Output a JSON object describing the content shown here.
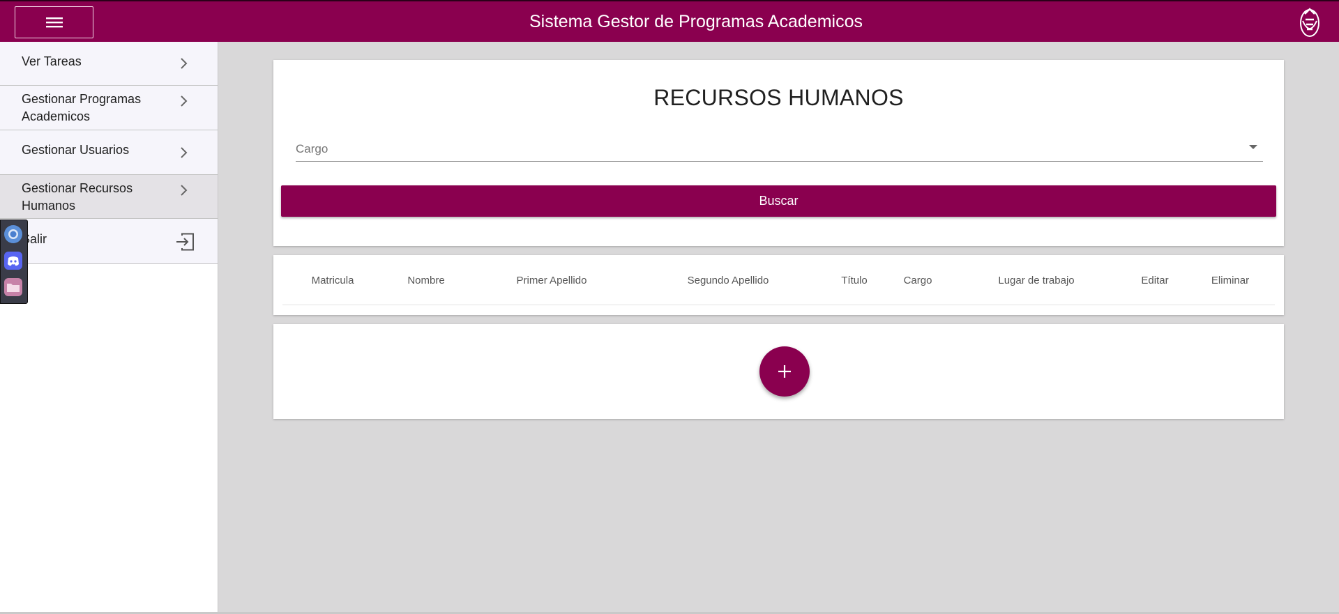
{
  "header": {
    "title": "Sistema Gestor de Programas Academicos",
    "menu_icon": "hamburger-menu-icon",
    "logo": "institution-logo",
    "brand_color": "#8a004f"
  },
  "sidebar": {
    "items": [
      {
        "label": "Ver Tareas",
        "icon": "chevron-right-icon"
      },
      {
        "label": "Gestionar Programas Academicos",
        "icon": "chevron-right-icon"
      },
      {
        "label": "Gestionar Usuarios",
        "icon": "chevron-right-icon"
      },
      {
        "label": "Gestionar Recursos Humanos",
        "icon": "chevron-right-icon",
        "active": true
      },
      {
        "label": "Salir",
        "icon": "logout-icon"
      }
    ]
  },
  "dock": {
    "apps": [
      "browser-icon",
      "discord-icon",
      "folder-icon"
    ]
  },
  "search_card": {
    "title": "RECURSOS HUMANOS",
    "select_placeholder": "Cargo",
    "search_button": "Buscar"
  },
  "table": {
    "columns": [
      "Matricula",
      "Nombre",
      "Primer Apellido",
      "Segundo Apellido",
      "Título",
      "Cargo",
      "Lugar de trabajo",
      "Editar",
      "Eliminar"
    ],
    "rows": []
  },
  "add_button": {
    "icon": "plus-icon"
  }
}
